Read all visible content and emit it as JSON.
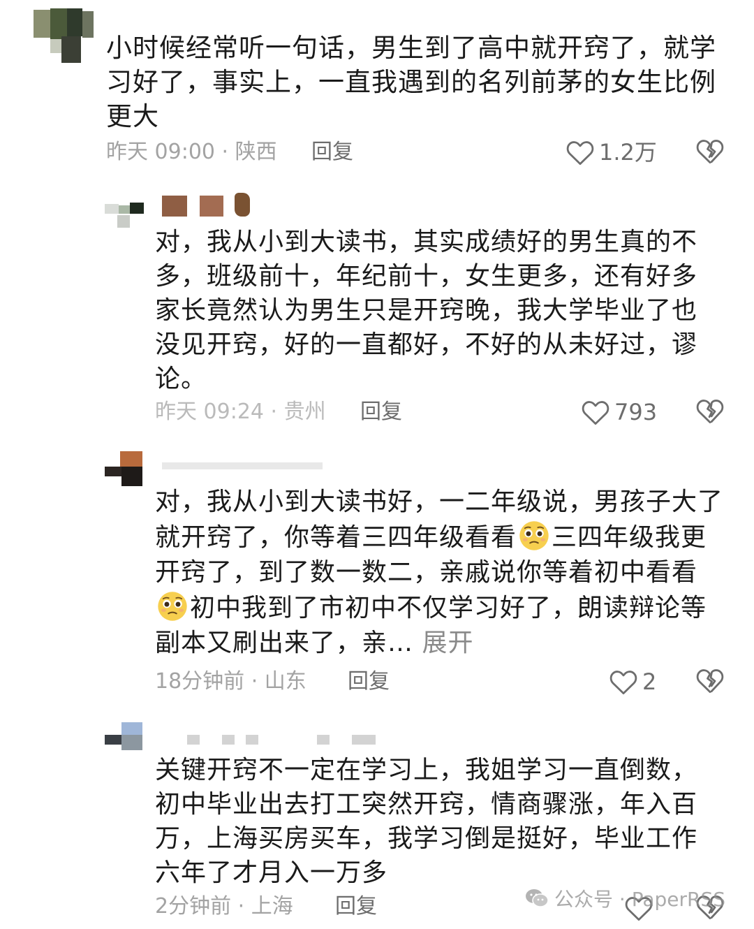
{
  "comments": [
    {
      "text": "小时候经常听一句话，男生到了高中就开窍了，就学习好了，事实上，一直我遇到的名列前茅的女生比例更大",
      "meta": "昨天 09:00 · 陕西",
      "reply_label": "回复",
      "likes": "1.2万"
    },
    {
      "text": "对，我从小到大读书，其实成绩好的男生真的不多，班级前十，年纪前十，女生更多，还有好多家长竟然认为男生只是开窍晚，我大学毕业了也没见开窍，好的一直都好，不好的从未好过，谬论。",
      "meta": "昨天 09:24 · 贵州",
      "reply_label": "回复",
      "likes": "793"
    },
    {
      "text_parts": [
        "对，我从小到大读书好，一二年级说，男孩子大了就开窍了，你等着三四年级看看",
        "三四年级我更开窍了，到了数一数二，亲戚说你等着初中看看",
        "初中我到了市初中不仅学习好了，朗读辩论等副本又刷出来了，亲…"
      ],
      "emoji": "pleading-face-emoji",
      "expand_label": "展开",
      "meta": "18分钟前 · 山东",
      "reply_label": "回复",
      "likes": "2"
    },
    {
      "text": "关键开窍不一定在学习上，我姐学习一直倒数，初中毕业出去打工突然开窍，情商骤涨，年入百万，上海买房买车，我学习倒是挺好，毕业工作六年了才月入一万多",
      "meta": "2分钟前 · 上海",
      "reply_label": "回复",
      "likes": ""
    }
  ],
  "watermark": {
    "label": "公众号 · PaperRSS",
    "icon": "wechat-icon"
  },
  "colors": {
    "text": "#1a1a1a",
    "meta": "#a3a3a3",
    "action": "#6d6d6d",
    "background": "#ffffff"
  }
}
